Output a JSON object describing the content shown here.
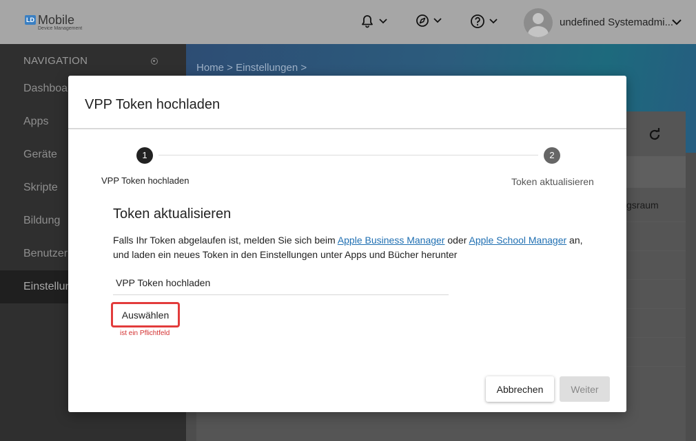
{
  "header": {
    "logo_badge": "LD",
    "logo_title": "Mobile",
    "logo_subtitle": "Device Management",
    "icons": [
      "bell-icon",
      "compass-icon",
      "help-icon"
    ],
    "username": "undefined Systemadmi..."
  },
  "sidebar": {
    "heading": "NAVIGATION",
    "items": [
      {
        "label": "Dashboard",
        "active": false
      },
      {
        "label": "Apps",
        "active": false
      },
      {
        "label": "Geräte",
        "active": false
      },
      {
        "label": "Skripte",
        "active": false
      },
      {
        "label": "Bildung",
        "active": false
      },
      {
        "label": "Benutzer",
        "active": false
      },
      {
        "label": "Einstellungen",
        "active": true
      }
    ]
  },
  "main": {
    "breadcrumb": "Home  >  Einstellungen  >",
    "partial_text": "gsraum"
  },
  "modal": {
    "title": "VPP Token hochladen",
    "steps": [
      {
        "number": "1",
        "label": "VPP Token hochladen"
      },
      {
        "number": "2",
        "label": "Token aktualisieren"
      }
    ],
    "section_title": "Token aktualisieren",
    "description": {
      "part1": "Falls Ihr Token abgelaufen ist, melden Sie sich beim ",
      "link1": "Apple Business Manager",
      "part2": " oder ",
      "link2": "Apple School Manager",
      "part3": " an, und laden ein neues Token in den Einstellungen unter Apps und Bücher herunter"
    },
    "file_label": "VPP Token hochladen",
    "choose_button": "Auswählen",
    "required_hint": "ist ein Pflichtfeld",
    "cancel_button": "Abbrechen",
    "next_button": "Weiter"
  },
  "colors": {
    "required_border": "#e23b3b",
    "link": "#1f6fb2",
    "required_text": "#d32f2f"
  }
}
